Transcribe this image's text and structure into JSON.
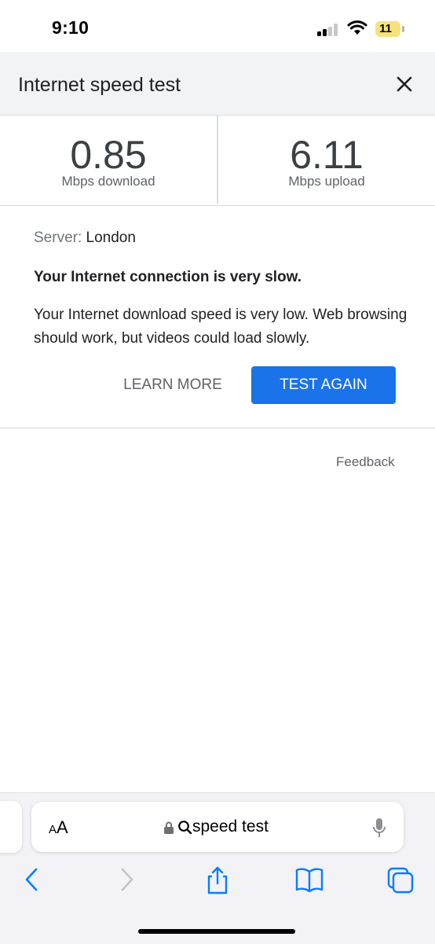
{
  "status_bar": {
    "time": "9:10",
    "battery": "11"
  },
  "header": {
    "title": "Internet speed test"
  },
  "results": {
    "download": {
      "value": "0.85",
      "unit": "Mbps download"
    },
    "upload": {
      "value": "6.11",
      "unit": "Mbps upload"
    }
  },
  "details": {
    "server_label": "Server:",
    "server_value": "London",
    "headline": "Your Internet connection is very slow.",
    "description": "Your Internet download speed is very low. Web browsing should work, but videos could load slowly."
  },
  "actions": {
    "learn_more": "LEARN MORE",
    "test_again": "TEST AGAIN"
  },
  "feedback": "Feedback",
  "browser": {
    "aa_label": "AA",
    "url": "speed test",
    "toolbar": [
      "back-icon",
      "forward-icon",
      "share-icon",
      "bookmarks-icon",
      "tabs-icon"
    ]
  },
  "colors": {
    "accent": "#1a73e8",
    "header_bg": "#f1f3f4",
    "safari_blue": "#0a7cff",
    "battery": "#f6e27a"
  }
}
